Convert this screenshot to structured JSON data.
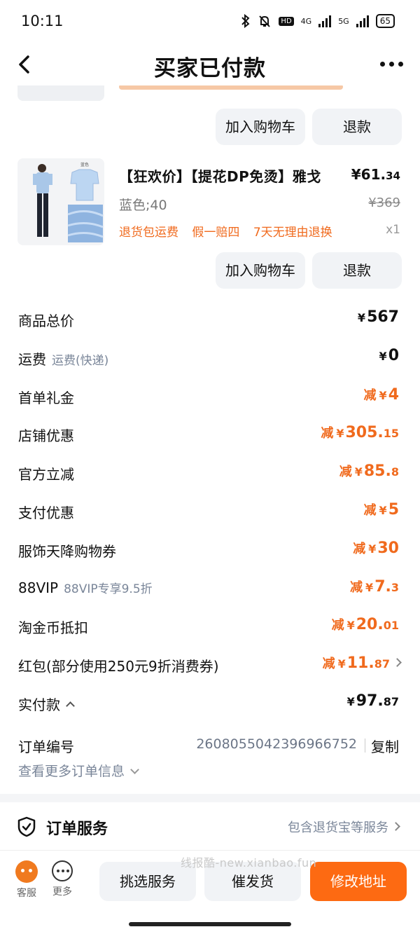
{
  "status_bar": {
    "time": "10:11",
    "net1": "4G",
    "net2": "5G",
    "battery": "65",
    "hd": "HD"
  },
  "header": {
    "title": "买家已付款"
  },
  "item1": {
    "add_cart": "加入购物车",
    "refund": "退款"
  },
  "item2": {
    "name": "【狂欢价】【提花DP免烫】雅戈",
    "price_int": "¥61.",
    "price_dec": "34",
    "spec": "蓝色;40",
    "orig_price": "¥369",
    "tags": [
      "退货包运费",
      "假一赔四",
      "7天无理由退换"
    ],
    "qty": "x1",
    "add_cart": "加入购物车",
    "refund": "退款",
    "swatch_label": "蓝色"
  },
  "summary": [
    {
      "label": "商品总价",
      "sub": "",
      "prefix": "",
      "currency": "¥",
      "int": "567",
      "dec": "",
      "orange": false
    },
    {
      "label": "运费",
      "sub": "运费(快递)",
      "prefix": "",
      "currency": "¥",
      "int": "0",
      "dec": "",
      "orange": false
    },
    {
      "label": "首单礼金",
      "sub": "",
      "prefix": "减",
      "currency": "¥",
      "int": "4",
      "dec": "",
      "orange": true
    },
    {
      "label": "店铺优惠",
      "sub": "",
      "prefix": "减",
      "currency": "¥",
      "int": "305.",
      "dec": "15",
      "orange": true
    },
    {
      "label": "官方立减",
      "sub": "",
      "prefix": "减",
      "currency": "¥",
      "int": "85.",
      "dec": "8",
      "orange": true
    },
    {
      "label": "支付优惠",
      "sub": "",
      "prefix": "减",
      "currency": "¥",
      "int": "5",
      "dec": "",
      "orange": true
    },
    {
      "label": "服饰天降购物券",
      "sub": "",
      "prefix": "减",
      "currency": "¥",
      "int": "30",
      "dec": "",
      "orange": true
    },
    {
      "label": "88VIP",
      "sub": "88VIP专享9.5折",
      "prefix": "减",
      "currency": "¥",
      "int": "7.",
      "dec": "3",
      "orange": true
    },
    {
      "label": "淘金币抵扣",
      "sub": "",
      "prefix": "减",
      "currency": "¥",
      "int": "20.",
      "dec": "01",
      "orange": true
    },
    {
      "label": "红包(部分使用250元9折消费券)",
      "sub": "",
      "prefix": "减",
      "currency": "¥",
      "int": "11.",
      "dec": "87",
      "orange": true
    }
  ],
  "paid": {
    "label": "实付款",
    "currency": "¥",
    "int": "97.",
    "dec": "87"
  },
  "order": {
    "label": "订单编号",
    "number": "2608055042396966752",
    "copy": "复制",
    "more_info": "查看更多订单信息"
  },
  "service": {
    "title": "订单服务",
    "desc": "包含退货宝等服务"
  },
  "watermark": "线报酷-new.xianbao.fun",
  "bottom": {
    "customer_service": "客服",
    "more": "更多",
    "pick_service": "挑选服务",
    "urge_ship": "催发货",
    "change_address": "修改地址"
  },
  "colors": {
    "accent_orange": "#f06a1d",
    "primary_button": "#fd6a12",
    "secondary_gray": "#7a8699",
    "button_bg": "#f1f3f6"
  }
}
